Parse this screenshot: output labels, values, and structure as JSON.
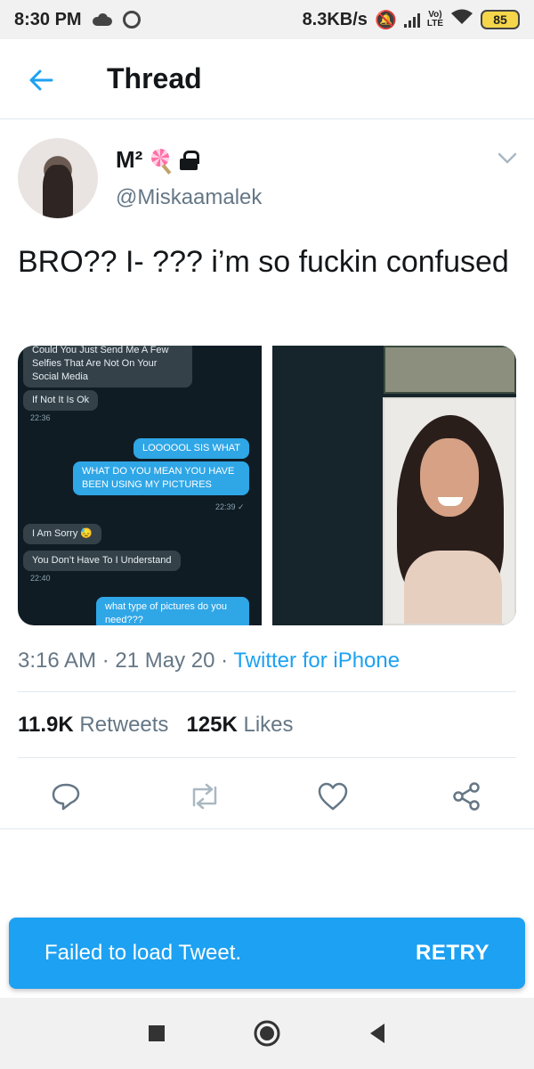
{
  "status_bar": {
    "time": "8:30 PM",
    "network_speed": "8.3KB/s",
    "volte_label": "Vo)\nLTE",
    "battery": "85"
  },
  "header": {
    "title": "Thread"
  },
  "tweet": {
    "display_name": "M²",
    "handle": "@Miskaamalek",
    "text": "BRO?? I- ??? i’m so fuckin confused",
    "timestamp": "3:16 AM · 21 May 20 · ",
    "source": "Twitter for iPhone",
    "retweets_count": "11.9K",
    "retweets_label": "Retweets",
    "likes_count": "125K",
    "likes_label": "Likes"
  },
  "media": {
    "chat": {
      "msg1": "Could You Just Send Me A Few Selfies That Are Not On Your Social Media",
      "msg2": "If Not It Is Ok",
      "time1": "22:36",
      "msg3": "LOOOOOL SIS WHAT",
      "msg4": "WHAT DO YOU MEAN YOU HAVE BEEN USING MY PICTURES",
      "time2": "22:39 ✓",
      "msg5": "I Am Sorry 😓",
      "msg6": "You Don’t Have To I Understand",
      "time3": "22:40",
      "msg7": "what type of pictures do you need???"
    }
  },
  "toast": {
    "message": "Failed to load Tweet.",
    "action": "RETRY"
  },
  "colors": {
    "accent": "#1da1f2",
    "text_primary": "#14171a",
    "text_secondary": "#657786"
  }
}
